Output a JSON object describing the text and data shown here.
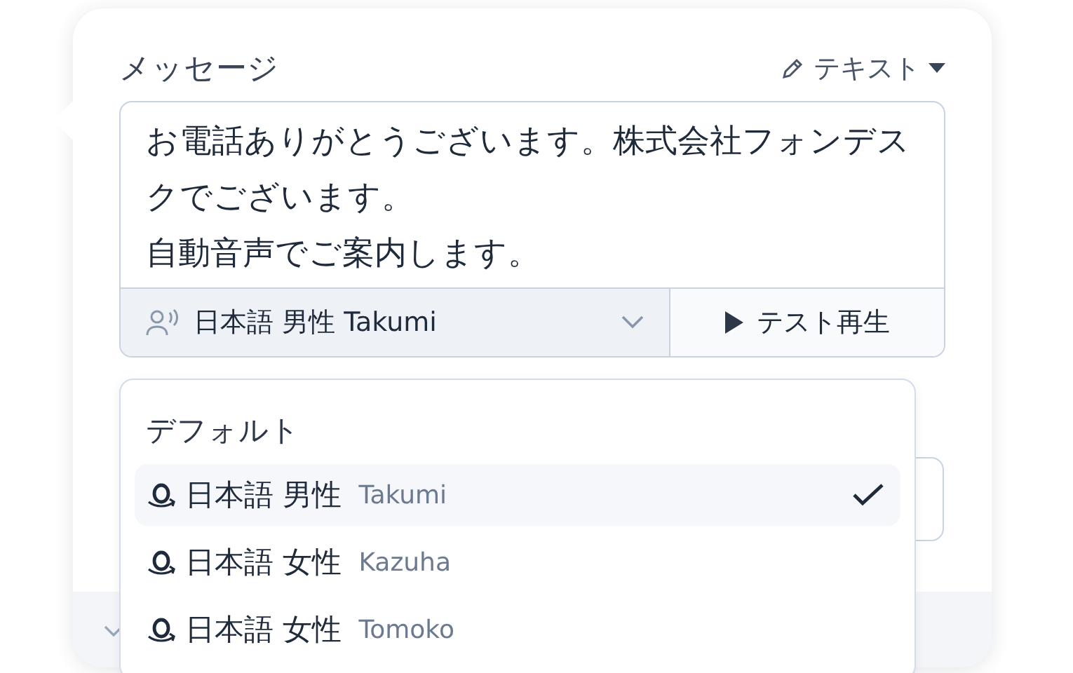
{
  "header": {
    "title": "メッセージ",
    "mode_label": "テキスト"
  },
  "message": {
    "paragraphs": [
      "お電話ありがとうございます。株式会社フォンデスクでございます。",
      "自動音声でご案内します。"
    ]
  },
  "voice_select": {
    "value": "日本語 男性 Takumi"
  },
  "test_button": {
    "label": "テスト再生"
  },
  "dropdown": {
    "group_label": "デフォルト",
    "options": [
      {
        "label": "日本語 男性",
        "voice": "Takumi",
        "selected": true
      },
      {
        "label": "日本語 女性",
        "voice": "Kazuha",
        "selected": false
      },
      {
        "label": "日本語 女性",
        "voice": "Tomoko",
        "selected": false
      }
    ]
  }
}
